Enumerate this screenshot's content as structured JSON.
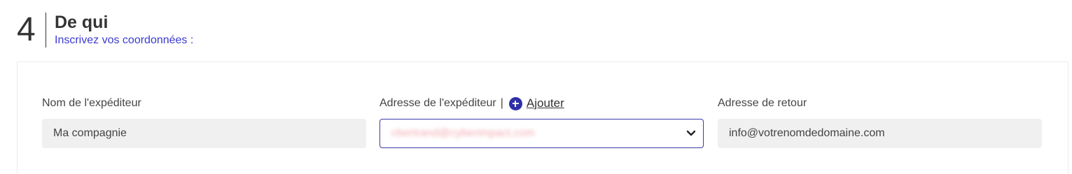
{
  "step": {
    "number": "4",
    "title": "De qui",
    "subtitle": "Inscrivez vos coordonnées",
    "subtitle_suffix": " :"
  },
  "form": {
    "sender_name": {
      "label": "Nom de l'expéditeur",
      "value": "Ma compagnie"
    },
    "sender_address": {
      "label": "Adresse de l'expéditeur",
      "separator": "|",
      "add_label": "Ajouter",
      "selected_value": "cbertrand@cyberimpact.com",
      "icon": "plus-circle-icon",
      "dropdown_icon": "chevron-down-icon"
    },
    "return_address": {
      "label": "Adresse de retour",
      "value": "info@votrenomdedomaine.com"
    }
  },
  "colors": {
    "accent": "#3b3bd2",
    "icon_blue": "#2f2fa8",
    "field_bg": "#f0f0f0",
    "select_border": "#3a3aa8"
  }
}
